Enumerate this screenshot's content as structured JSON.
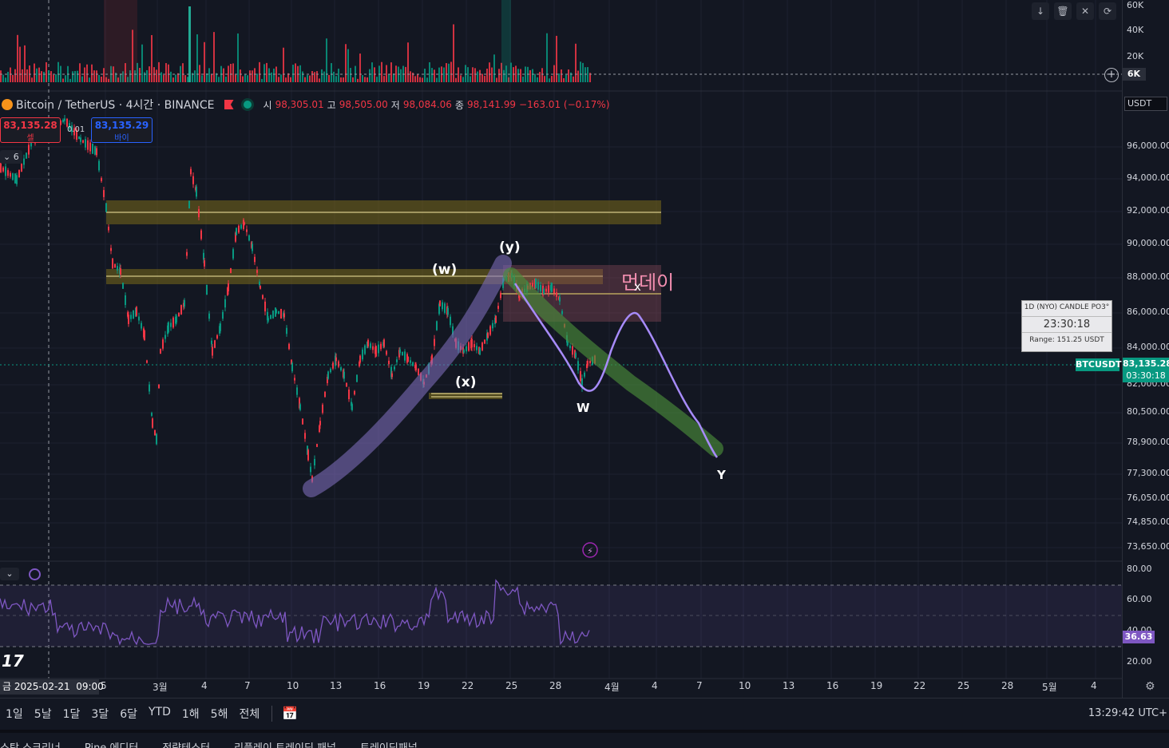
{
  "symbol": {
    "name": "Bitcoin / TetherUS · 4시간 · BINANCE",
    "open_label": "시",
    "open": "98,305.01",
    "high_label": "고",
    "high": "98,505.00",
    "low_label": "저",
    "low": "98,084.06",
    "close_label": "종",
    "close": "98,141.99",
    "change": "−163.01 (−0.17%)"
  },
  "trade": {
    "sell_price": "83,135.28",
    "sell_label": "셀",
    "spread": "0.01",
    "buy_price": "83,135.29",
    "buy_label": "바이",
    "collapse_count": "6"
  },
  "volume_axis": [
    "60K",
    "40K",
    "20K"
  ],
  "volume_current": "6K",
  "currency": "USDT",
  "price_axis": [
    "96,000.00",
    "94,000.00",
    "92,000.00",
    "90,000.00",
    "88,000.00",
    "86,000.00",
    "84,000.00",
    "82,000.00",
    "80,500.00",
    "78,900.00",
    "77,300.00",
    "76,050.00",
    "74,850.00",
    "73,650.00"
  ],
  "current_price": "83,135.28",
  "countdown": "03:30:18",
  "ticker_tag": "BTCUSDT",
  "candle_widget": {
    "title": "1D (NYO) CANDLE PO3°",
    "timer": "23:30:18",
    "range": "Range: 151.25 USDT"
  },
  "annotations": {
    "w_paren": "(w)",
    "y_paren": "(y)",
    "x_paren": "(x)",
    "monday": "먼데이",
    "x_small": "x",
    "w": "W",
    "y": "Y"
  },
  "rsi_axis": [
    "80.00",
    "60.00",
    "40.00",
    "20.00"
  ],
  "rsi_value": "36.63",
  "time_axis": [
    "5",
    "3월",
    "4",
    "7",
    "10",
    "13",
    "16",
    "19",
    "22",
    "25",
    "28",
    "4월",
    "4",
    "7",
    "10",
    "13",
    "16",
    "19",
    "22",
    "25",
    "28",
    "5월",
    "4"
  ],
  "time_cursor": "금 2025-02-21",
  "time_cursor_hour": "09:00",
  "logo": "17",
  "ranges": [
    "1일",
    "5날",
    "1달",
    "3달",
    "6달",
    "YTD",
    "1해",
    "5해",
    "전체"
  ],
  "clock": "13:29:42 UTC+",
  "panels": [
    "스탁 스크리너",
    "Pine 에디터",
    "전략테스터",
    "리플레이 트레이딩 패널",
    "트레이딩패널"
  ],
  "colors": {
    "up": "#089981",
    "down": "#f23645",
    "bg": "#131722",
    "accent": "#2962ff",
    "rsi": "#7e57c2"
  }
}
